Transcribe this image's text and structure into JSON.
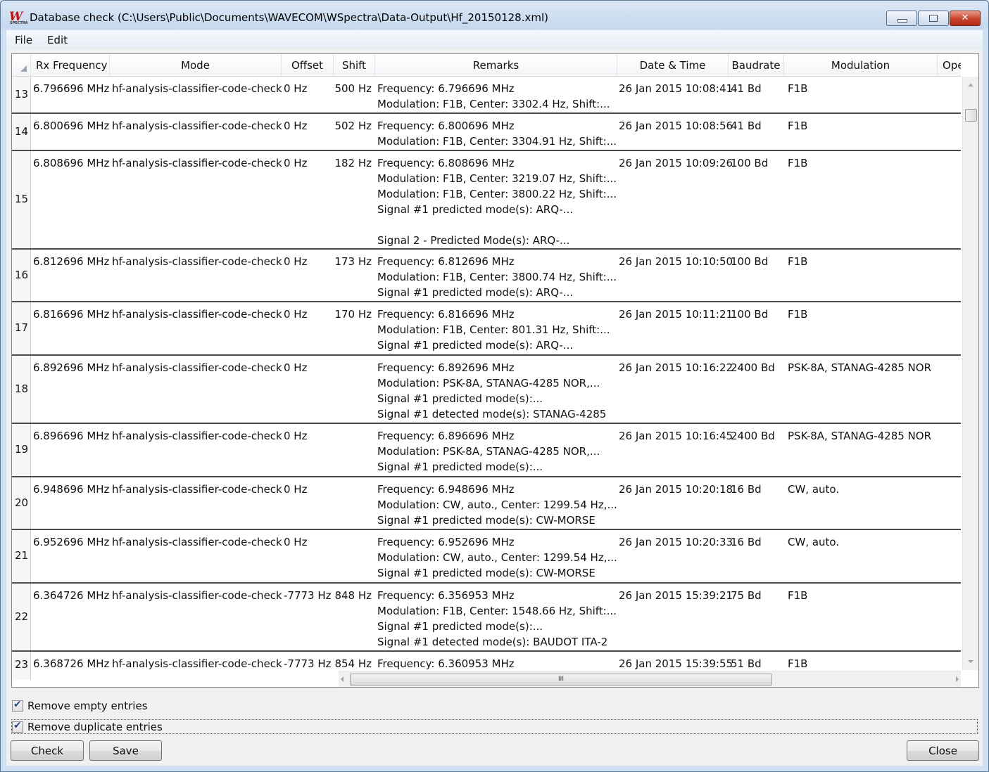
{
  "window": {
    "title": "Database check (C:\\Users\\Public\\Documents\\WAVECOM\\WSpectra\\Data-Output\\Hf_20150128.xml)",
    "icon": "wavecom-w-icon",
    "icon_text": "W",
    "icon_subtext": "SPECTRA"
  },
  "menu": {
    "file": "File",
    "edit": "Edit"
  },
  "columns": {
    "rx_frequency": "Rx Frequency",
    "mode": "Mode",
    "offset": "Offset",
    "shift": "Shift",
    "remarks": "Remarks",
    "date_time": "Date & Time",
    "baudrate": "Baudrate",
    "modulation": "Modulation",
    "operator": "Ope"
  },
  "rows": [
    {
      "num": "13",
      "rx": "6.796696 MHz",
      "mode": "hf-analysis-classifier-code-check",
      "offset": "0 Hz",
      "shift": "500 Hz",
      "remarks": [
        "Frequency: 6.796696 MHz",
        "Modulation: F1B, Center: 3302.4 Hz, Shift:..."
      ],
      "date": "26 Jan 2015 10:08:41",
      "baud": "41 Bd",
      "modulation": "F1B"
    },
    {
      "num": "14",
      "rx": "6.800696 MHz",
      "mode": "hf-analysis-classifier-code-check",
      "offset": "0 Hz",
      "shift": "502 Hz",
      "remarks": [
        "Frequency: 6.800696 MHz",
        "Modulation: F1B, Center: 3304.91 Hz, Shift:..."
      ],
      "date": "26 Jan 2015 10:08:56",
      "baud": "41 Bd",
      "modulation": "F1B"
    },
    {
      "num": "15",
      "rx": "6.808696 MHz",
      "mode": "hf-analysis-classifier-code-check",
      "offset": "0 Hz",
      "shift": "182 Hz",
      "remarks": [
        "Frequency: 6.808696 MHz",
        "Modulation: F1B, Center: 3219.07 Hz, Shift:...",
        "Modulation: F1B, Center: 3800.22 Hz, Shift:...",
        "Signal #1 predicted mode(s): ARQ-...",
        "",
        " Signal 2 - Predicted Mode(s): ARQ-..."
      ],
      "date": "26 Jan 2015 10:09:26",
      "baud": "100 Bd",
      "modulation": "F1B"
    },
    {
      "num": "16",
      "rx": "6.812696 MHz",
      "mode": "hf-analysis-classifier-code-check",
      "offset": "0 Hz",
      "shift": "173 Hz",
      "remarks": [
        "Frequency: 6.812696 MHz",
        "Modulation: F1B, Center: 3800.74 Hz, Shift:...",
        "Signal #1 predicted mode(s): ARQ-..."
      ],
      "date": "26 Jan 2015 10:10:50",
      "baud": "100 Bd",
      "modulation": "F1B"
    },
    {
      "num": "17",
      "rx": "6.816696 MHz",
      "mode": "hf-analysis-classifier-code-check",
      "offset": "0 Hz",
      "shift": "170 Hz",
      "remarks": [
        "Frequency: 6.816696 MHz",
        "Modulation: F1B, Center: 801.31 Hz, Shift:...",
        "Signal #1 predicted mode(s): ARQ-..."
      ],
      "date": "26 Jan 2015 10:11:21",
      "baud": "100 Bd",
      "modulation": "F1B"
    },
    {
      "num": "18",
      "rx": "6.892696 MHz",
      "mode": "hf-analysis-classifier-code-check",
      "offset": "0 Hz",
      "shift": "",
      "remarks": [
        "Frequency: 6.892696 MHz",
        "Modulation: PSK-8A, STANAG-4285 NOR,...",
        "Signal #1 predicted mode(s):...",
        "Signal #1 detected mode(s): STANAG-4285"
      ],
      "date": "26 Jan 2015 10:16:22",
      "baud": "2400 Bd",
      "modulation": "PSK-8A, STANAG-4285 NOR"
    },
    {
      "num": "19",
      "rx": "6.896696 MHz",
      "mode": "hf-analysis-classifier-code-check",
      "offset": "0 Hz",
      "shift": "",
      "remarks": [
        "Frequency: 6.896696 MHz",
        "Modulation: PSK-8A, STANAG-4285 NOR,...",
        "Signal #1 predicted mode(s):..."
      ],
      "date": "26 Jan 2015 10:16:45",
      "baud": "2400 Bd",
      "modulation": "PSK-8A, STANAG-4285 NOR"
    },
    {
      "num": "20",
      "rx": "6.948696 MHz",
      "mode": "hf-analysis-classifier-code-check",
      "offset": "0 Hz",
      "shift": "",
      "remarks": [
        "Frequency: 6.948696 MHz",
        "Modulation: CW, auto., Center: 1299.54 Hz,...",
        "Signal #1 predicted mode(s): CW-MORSE"
      ],
      "date": "26 Jan 2015 10:20:18",
      "baud": "16 Bd",
      "modulation": "CW, auto."
    },
    {
      "num": "21",
      "rx": "6.952696 MHz",
      "mode": "hf-analysis-classifier-code-check",
      "offset": "0 Hz",
      "shift": "",
      "remarks": [
        "Frequency: 6.952696 MHz",
        "Modulation: CW, auto., Center: 1299.54 Hz,...",
        "Signal #1 predicted mode(s): CW-MORSE"
      ],
      "date": "26 Jan 2015 10:20:33",
      "baud": "16 Bd",
      "modulation": "CW, auto."
    },
    {
      "num": "22",
      "rx": "6.364726 MHz",
      "mode": "hf-analysis-classifier-code-check",
      "offset": "-7773 Hz",
      "shift": "848 Hz",
      "remarks": [
        "Frequency: 6.356953 MHz",
        "Modulation: F1B, Center: 1548.66 Hz, Shift:...",
        "Signal #1 predicted mode(s):...",
        "Signal #1 detected mode(s): BAUDOT ITA-2"
      ],
      "date": "26 Jan 2015 15:39:21",
      "baud": "75 Bd",
      "modulation": "F1B"
    },
    {
      "num": "23",
      "rx": "6.368726 MHz",
      "mode": "hf-analysis-classifier-code-check",
      "offset": "-7773 Hz",
      "shift": "854 Hz",
      "remarks": [
        "Frequency: 6.360953 MHz"
      ],
      "date": "26 Jan 2015 15:39:55",
      "baud": "51 Bd",
      "modulation": "F1B"
    }
  ],
  "scrollbar": {
    "grip": "III"
  },
  "options": {
    "remove_empty": {
      "label": "Remove empty entries",
      "checked": true
    },
    "remove_duplicate": {
      "label": "Remove duplicate entries",
      "checked": true
    }
  },
  "buttons": {
    "check": "Check",
    "save": "Save",
    "close": "Close"
  },
  "colors": {
    "close_button": "#c9412a",
    "window_frame": "#cfe0f3",
    "row_separator": "#4a4a4a"
  }
}
